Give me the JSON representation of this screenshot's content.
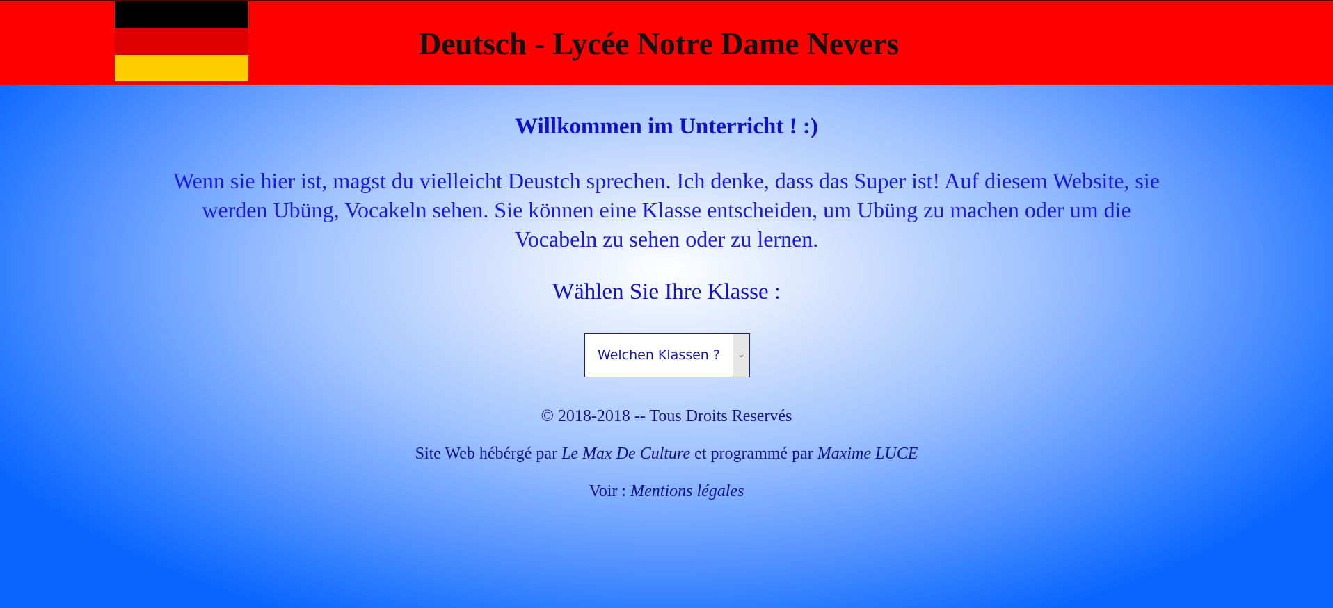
{
  "header": {
    "title": "Deutsch - Lycée Notre Dame Nevers",
    "flag_icon": "german-flag-icon",
    "background_color": "#ff0000"
  },
  "main": {
    "welcome": "Willkommen im Unterricht ! :)",
    "intro": "Wenn sie hier ist, magst du vielleicht Deustch sprechen. Ich denke, dass das Super ist! Auf diesem Website, sie werden Ubüng, Vocakeln sehen. Sie können eine Klasse entscheiden, um Ubüng zu machen oder um die Vocabeln zu sehen oder zu lernen.",
    "choose_label": "Wählen Sie Ihre Klasse :",
    "class_select": {
      "selected": "Welchen Klassen ?"
    },
    "text_color": "#1a1ae0"
  },
  "footer": {
    "copyright": "© 2018-2018 -- Tous Droits Reservés",
    "hosted_prefix": "Site Web hébérgé par ",
    "host_name": "Le Max De Culture",
    "hosted_middle": " et programmé par ",
    "programmer": "Maxime LUCE",
    "legal_prefix": "Voir : ",
    "legal_link": "Mentions légales"
  },
  "colors": {
    "flag_black": "#000000",
    "flag_red": "#dd0000",
    "flag_gold": "#ffce00",
    "background_center": "#ffffff",
    "background_edge": "#0a66ff"
  }
}
